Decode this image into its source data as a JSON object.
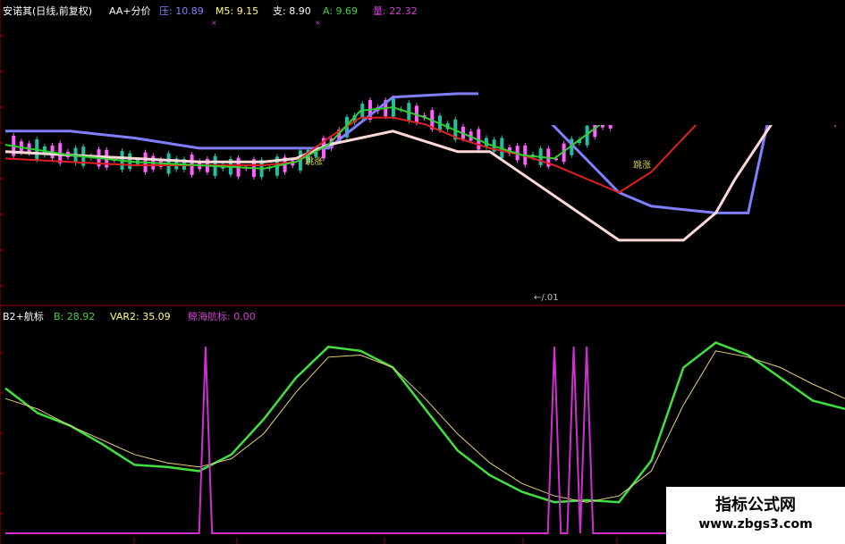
{
  "header_top": {
    "title": "安诺其(日线,前复权)",
    "indicator": "AA+分价",
    "items": [
      {
        "label": "压:",
        "value": "10.89",
        "color": "#8080ff"
      },
      {
        "label": "M5:",
        "value": "9.15",
        "color": "#ffff80"
      },
      {
        "label": "支:",
        "value": "8.90",
        "color": "#ffffff"
      },
      {
        "label": "A:",
        "value": "9.69",
        "color": "#40d040"
      },
      {
        "label": "量:",
        "value": "22.32",
        "color": "#d040d0"
      }
    ]
  },
  "header_bottom": {
    "title": "B2+航标",
    "items": [
      {
        "label": "B:",
        "value": "28.92",
        "color": "#40d040"
      },
      {
        "label": "VAR2:",
        "value": "35.09",
        "color": "#ffff80"
      },
      {
        "label": "鲸海航标:",
        "value": "0.00",
        "color": "#d040d0"
      }
    ]
  },
  "annotations": {
    "buy1": "跳涨",
    "buy2": "跳涨",
    "arrow_label": "←/.01"
  },
  "watermark": {
    "title": "指标公式网",
    "url": "www.zbgs3.com"
  },
  "colors": {
    "pressure": "#7f7fff",
    "support": "#ffd8d8",
    "ma_red": "#e02020",
    "ma_green": "#30d030",
    "ma_white": "#ffffff",
    "b_line": "#40e040",
    "var2_line": "#e8d080",
    "spike": "#d030d0",
    "candle_up": "#ff60ff",
    "candle_down": "#20c0a0"
  },
  "chart_data": [
    {
      "type": "line",
      "panel": "price",
      "x_index_range": [
        0,
        130
      ],
      "ylim": [
        7.6,
        11.4
      ],
      "series": [
        {
          "name": "压",
          "role": "pressure",
          "x": [
            0,
            10,
            20,
            30,
            40,
            50,
            60,
            70,
            80,
            95,
            100,
            110,
            115,
            120,
            128,
            130
          ],
          "values": [
            10.0,
            10.0,
            9.9,
            9.75,
            9.75,
            9.75,
            10.5,
            10.55,
            10.55,
            9.1,
            8.9,
            8.8,
            8.8,
            11.0,
            10.7,
            10.6
          ]
        },
        {
          "name": "支",
          "role": "support",
          "x": [
            0,
            20,
            30,
            40,
            45,
            50,
            60,
            70,
            75,
            95,
            100,
            105,
            110,
            113,
            120,
            125,
            130
          ],
          "values": [
            9.7,
            9.6,
            9.55,
            9.55,
            9.6,
            9.8,
            10.0,
            9.7,
            9.7,
            8.4,
            8.4,
            8.4,
            8.8,
            9.3,
            10.3,
            10.3,
            10.3
          ]
        },
        {
          "name": "M5",
          "role": "ma_red",
          "x": [
            0,
            10,
            20,
            30,
            40,
            45,
            50,
            55,
            60,
            65,
            70,
            75,
            80,
            85,
            95,
            100,
            105,
            110,
            115,
            120,
            125,
            130
          ],
          "values": [
            9.6,
            9.55,
            9.5,
            9.5,
            9.5,
            9.55,
            9.9,
            10.2,
            10.2,
            10.1,
            9.9,
            9.75,
            9.65,
            9.5,
            9.1,
            9.4,
            9.9,
            10.4,
            10.9,
            11.1,
            10.9,
            10.7
          ]
        },
        {
          "name": "A",
          "role": "ma_green",
          "x": [
            0,
            10,
            20,
            30,
            40,
            45,
            50,
            55,
            60,
            65,
            70,
            75,
            80,
            85,
            95,
            100,
            105,
            110,
            115,
            120,
            125,
            130
          ],
          "values": [
            9.8,
            9.65,
            9.55,
            9.5,
            9.45,
            9.55,
            9.8,
            10.3,
            10.35,
            10.2,
            10.0,
            9.8,
            9.65,
            9.6,
            10.3,
            10.7,
            11.0,
            10.9,
            10.6,
            10.4,
            10.3,
            10.2
          ]
        }
      ]
    },
    {
      "type": "line",
      "panel": "indicator",
      "x_index_range": [
        0,
        130
      ],
      "ylim": [
        0,
        100
      ],
      "series": [
        {
          "name": "B",
          "role": "b_line",
          "x": [
            0,
            5,
            10,
            15,
            20,
            25,
            30,
            35,
            40,
            45,
            50,
            55,
            60,
            65,
            70,
            75,
            80,
            85,
            90,
            95,
            100,
            105,
            110,
            115,
            120,
            125,
            130
          ],
          "values": [
            70,
            58,
            52,
            43,
            33,
            32,
            30,
            38,
            55,
            75,
            90,
            88,
            80,
            60,
            40,
            28,
            20,
            15,
            16,
            15,
            35,
            80,
            92,
            86,
            75,
            64,
            60
          ]
        },
        {
          "name": "VAR2",
          "role": "var2_line",
          "x": [
            0,
            5,
            10,
            15,
            20,
            25,
            30,
            35,
            40,
            45,
            50,
            55,
            60,
            65,
            70,
            75,
            80,
            85,
            90,
            95,
            100,
            105,
            110,
            115,
            120,
            125,
            130
          ],
          "values": [
            65,
            60,
            52,
            45,
            38,
            34,
            32,
            36,
            48,
            68,
            85,
            86,
            80,
            65,
            48,
            34,
            24,
            18,
            15,
            18,
            30,
            62,
            88,
            85,
            80,
            72,
            65
          ]
        },
        {
          "name": "鲸海航标",
          "role": "spike",
          "x": [
            0,
            30,
            31,
            32,
            33,
            60,
            84,
            85,
            86,
            87,
            88,
            89,
            90,
            91,
            92,
            130
          ],
          "values": [
            0,
            0,
            90,
            0,
            0,
            0,
            0,
            90,
            0,
            0,
            90,
            0,
            90,
            0,
            0,
            0
          ]
        }
      ]
    }
  ]
}
